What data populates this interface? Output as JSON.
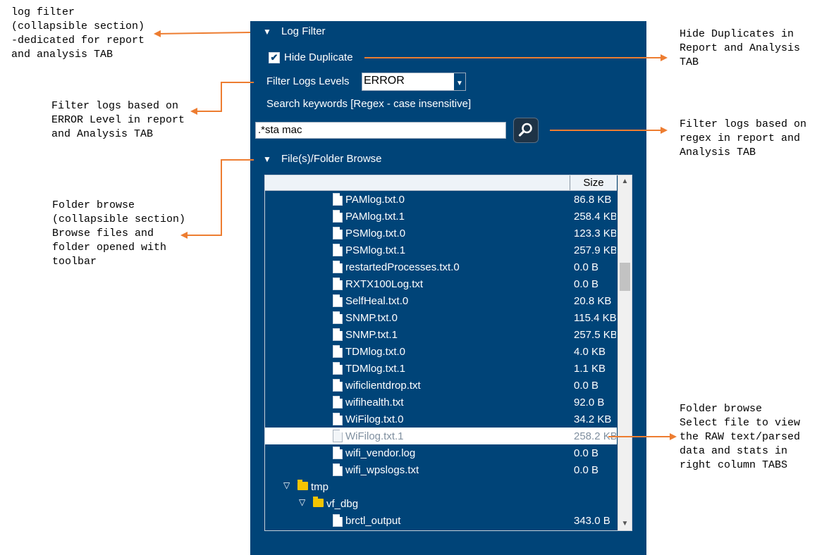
{
  "annotations": {
    "log_filter": "log filter\n(collapsible section)\n-dedicated for report\nand analysis TAB",
    "hide_duplicates": "Hide Duplicates in\nReport and Analysis\nTAB",
    "filter_level": "Filter logs based on\nERROR Level in report\nand Analysis TAB",
    "filter_regex": "Filter logs based on\nregex in report and\nAnalysis TAB",
    "folder_browse": "Folder browse\n(collapsible section)\nBrowse files and\nfolder opened with\ntoolbar",
    "select_file": "Folder browse\nSelect file to view\nthe RAW text/parsed\ndata and stats in\nright  column TABS"
  },
  "panel": {
    "log_filter_title": "Log Filter",
    "hide_duplicate_label": "Hide Duplicate",
    "hide_duplicate_checked": true,
    "filter_level_label": "Filter Logs Levels",
    "filter_level_value": "ERROR",
    "search_label": "Search keywords [Regex - case insensitive]",
    "search_value": ".*sta mac",
    "browse_title": "File(s)/Folder Browse",
    "size_header": "Size"
  },
  "files": [
    {
      "name": "PAMlog.txt.0",
      "size": "86.8 KB",
      "type": "file"
    },
    {
      "name": "PAMlog.txt.1",
      "size": "258.4 KB",
      "type": "file"
    },
    {
      "name": "PSMlog.txt.0",
      "size": "123.3 KB",
      "type": "file"
    },
    {
      "name": "PSMlog.txt.1",
      "size": "257.9 KB",
      "type": "file"
    },
    {
      "name": "restartedProcesses.txt.0",
      "size": "0.0 B",
      "type": "file"
    },
    {
      "name": "RXTX100Log.txt",
      "size": "0.0 B",
      "type": "file"
    },
    {
      "name": "SelfHeal.txt.0",
      "size": "20.8 KB",
      "type": "file"
    },
    {
      "name": "SNMP.txt.0",
      "size": "115.4 KB",
      "type": "file"
    },
    {
      "name": "SNMP.txt.1",
      "size": "257.5 KB",
      "type": "file"
    },
    {
      "name": "TDMlog.txt.0",
      "size": "4.0 KB",
      "type": "file"
    },
    {
      "name": "TDMlog.txt.1",
      "size": "1.1 KB",
      "type": "file"
    },
    {
      "name": "wificlientdrop.txt",
      "size": "0.0 B",
      "type": "file"
    },
    {
      "name": "wifihealth.txt",
      "size": "92.0 B",
      "type": "file"
    },
    {
      "name": "WiFilog.txt.0",
      "size": "34.2 KB",
      "type": "file"
    },
    {
      "name": "WiFilog.txt.1",
      "size": "258.2 KB",
      "type": "file",
      "selected": true
    },
    {
      "name": "wifi_vendor.log",
      "size": "0.0 B",
      "type": "file"
    },
    {
      "name": "wifi_wpslogs.txt",
      "size": "0.0 B",
      "type": "file"
    },
    {
      "name": "tmp",
      "size": "",
      "type": "folder"
    },
    {
      "name": "vf_dbg",
      "size": "",
      "type": "folder"
    },
    {
      "name": "brctl_output",
      "size": "343.0 B",
      "type": "file"
    }
  ],
  "colors": {
    "panel_bg": "#004478",
    "arrow": "#ed7d31",
    "folder": "#f5c400"
  },
  "icons": {
    "section_toggle": "triangle-down-icon",
    "search": "magnifier-icon",
    "file": "file-icon",
    "folder": "folder-icon"
  }
}
